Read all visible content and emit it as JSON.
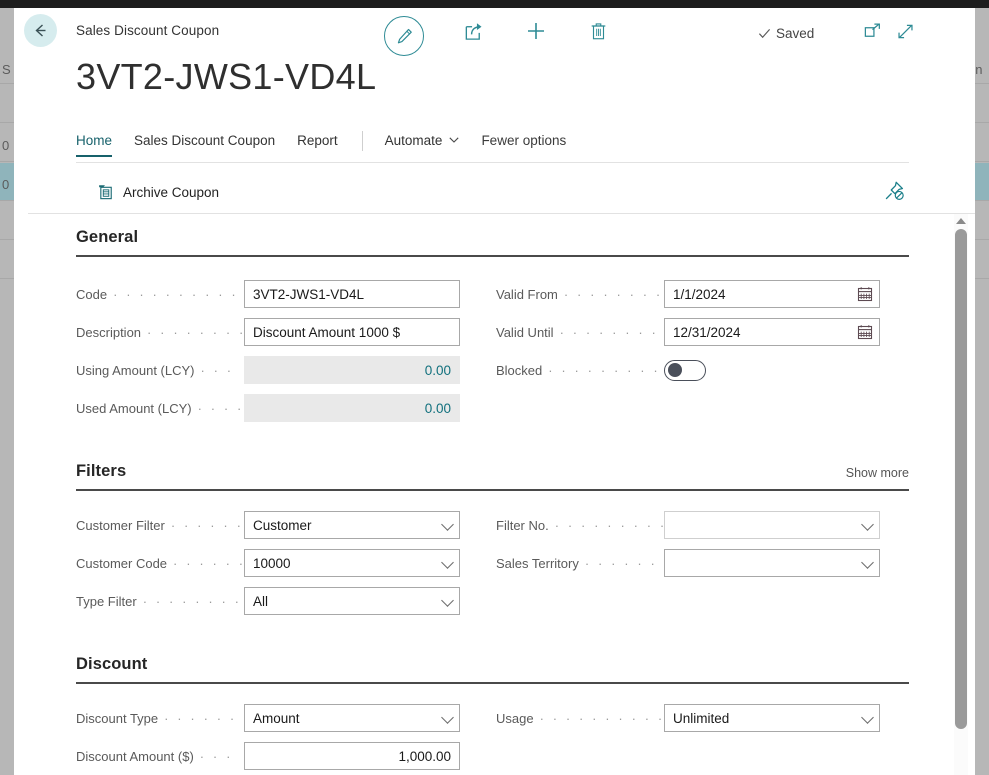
{
  "background_list": {
    "left_fragments": [
      "S",
      "S",
      "0",
      "0"
    ],
    "right_fragments": [
      "on"
    ]
  },
  "topbar": {
    "breadcrumb": "Sales Discount Coupon",
    "back_label": "Back",
    "edit_label": "Edit",
    "share_label": "Share",
    "new_label": "New",
    "delete_label": "Delete",
    "saved_label": "Saved",
    "saved_check": "✓",
    "open_in_new_label": "Open in new window",
    "expand_label": "Expand"
  },
  "page": {
    "title": "3VT2-JWS1-VD4L"
  },
  "tabs": [
    {
      "label": "Home",
      "active": true
    },
    {
      "label": "Sales Discount Coupon",
      "active": false
    },
    {
      "label": "Report",
      "active": false
    },
    {
      "label": "Automate",
      "active": false,
      "caret": true
    },
    {
      "label": "Fewer options",
      "active": false
    }
  ],
  "actionbar": {
    "archive_coupon": "Archive Coupon",
    "unpin_label": "Unpin"
  },
  "sections": {
    "general": {
      "title": "General",
      "left_fields": [
        {
          "label": "Code",
          "value": "3VT2-JWS1-VD4L",
          "type": "text"
        },
        {
          "label": "Description",
          "value": "Discount Amount 1000 $",
          "type": "text"
        },
        {
          "label": "Using Amount (LCY)",
          "value": "0.00",
          "type": "readonly"
        },
        {
          "label": "Used Amount (LCY)",
          "value": "0.00",
          "type": "readonly"
        }
      ],
      "right_fields": [
        {
          "label": "Valid From",
          "value": "1/1/2024",
          "type": "date"
        },
        {
          "label": "Valid Until",
          "value": "12/31/2024",
          "type": "date"
        },
        {
          "label": "Blocked",
          "value": "",
          "type": "toggle",
          "checked": false
        }
      ]
    },
    "filters": {
      "title": "Filters",
      "show_more": "Show more",
      "left_fields": [
        {
          "label": "Customer Filter",
          "value": "Customer",
          "type": "select"
        },
        {
          "label": "Customer Code",
          "value": "10000",
          "type": "select"
        },
        {
          "label": "Type Filter",
          "value": "All",
          "type": "select"
        }
      ],
      "right_fields": [
        {
          "label": "Filter No.",
          "value": "",
          "type": "select"
        },
        {
          "label": "Sales Territory",
          "value": "",
          "type": "select"
        }
      ]
    },
    "discount": {
      "title": "Discount",
      "left_fields": [
        {
          "label": "Discount Type",
          "value": "Amount",
          "type": "select"
        },
        {
          "label": "Discount Amount ($)",
          "value": "1,000.00",
          "type": "number"
        }
      ],
      "right_fields": [
        {
          "label": "Usage",
          "value": "Unlimited",
          "type": "select"
        }
      ]
    }
  },
  "colors": {
    "accent": "#17616b",
    "icon_teal": "#2e8b95",
    "readonly_text": "#11707d",
    "back_circle": "#d6ecee",
    "selected_row": "#8fb4bb"
  },
  "scrollbar": {
    "position_percent": 2
  }
}
